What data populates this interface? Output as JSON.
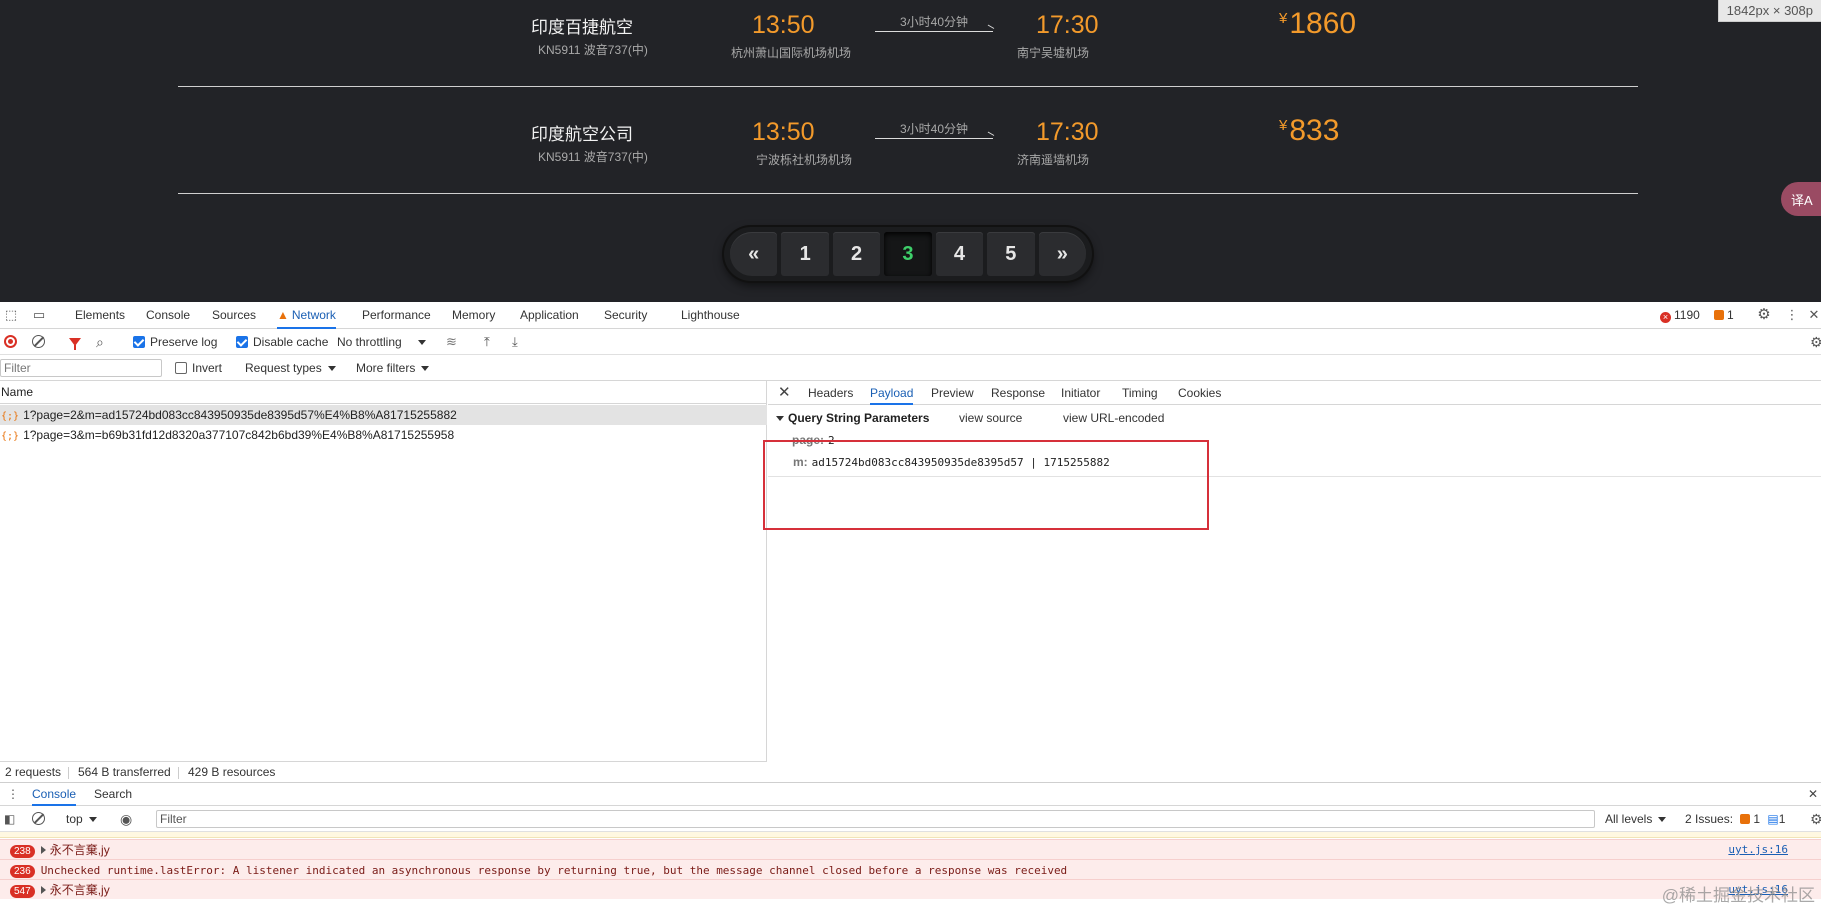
{
  "page": {
    "dimension_badge": "1842px × 308p",
    "flights": [
      {
        "airline": "印度百捷航空",
        "flight_no": "KN5911 波音737(中)",
        "dep_time": "13:50",
        "dep_airport": "杭州萧山国际机场机场",
        "duration": "3小时40分钟",
        "arr_time": "17:30",
        "arr_airport": "南宁吴墟机场",
        "currency": "¥",
        "price": "1860"
      },
      {
        "airline": "印度航空公司",
        "flight_no": "KN5911 波音737(中)",
        "dep_time": "13:50",
        "dep_airport": "宁波栎社机场机场",
        "duration": "3小时40分钟",
        "arr_time": "17:30",
        "arr_airport": "济南遥墙机场",
        "currency": "¥",
        "price": "833"
      }
    ],
    "pagination": {
      "prev": "«",
      "pages": [
        "1",
        "2",
        "3",
        "4",
        "5"
      ],
      "current": "3",
      "next": "»"
    },
    "translate_button": "译A"
  },
  "devtools": {
    "main_tabs": [
      "Elements",
      "Console",
      "Sources",
      "Network",
      "Performance",
      "Memory",
      "Application",
      "Security",
      "Lighthouse"
    ],
    "active_tab": "Network",
    "error_count": "1190",
    "warning_count": "1",
    "toolbar": {
      "preserve_log": "Preserve log",
      "disable_cache": "Disable cache",
      "throttling": "No throttling"
    },
    "filterbar": {
      "filter_placeholder": "Filter",
      "invert": "Invert",
      "request_types": "Request types",
      "more_filters": "More filters"
    },
    "requests": {
      "column_name": "Name",
      "rows": [
        "1?page=2&m=ad15724bd083cc843950935de8395d57%E4%B8%A81715255882",
        "1?page=3&m=b69b31fd12d8320a377107c842b6bd39%E4%B8%A81715255958"
      ]
    },
    "status": {
      "requests": "2 requests",
      "transferred": "564 B transferred",
      "resources": "429 B resources"
    },
    "detail_tabs": [
      "Headers",
      "Payload",
      "Preview",
      "Response",
      "Initiator",
      "Timing",
      "Cookies"
    ],
    "active_detail_tab": "Payload",
    "payload": {
      "section_title": "Query String Parameters",
      "view_source": "view source",
      "view_url_encoded": "view URL-encoded",
      "params": [
        {
          "key": "page:",
          "value": "2"
        },
        {
          "key": "m:",
          "value": "ad15724bd083cc843950935de8395d57 | 1715255882"
        }
      ]
    },
    "drawer": {
      "tabs": [
        "Console",
        "Search"
      ],
      "context": "top",
      "filter_placeholder": "Filter",
      "levels": "All levels",
      "issues_label": "2 Issues:",
      "issues_warn": "1",
      "issues_info": "1",
      "logs": [
        {
          "count": "238",
          "text": "永不言棄,jy",
          "source": "uyt.js:16"
        },
        {
          "count": "236",
          "text": "Unchecked runtime.lastError: A listener indicated an asynchronous response by returning true, but the message channel closed before a response was received",
          "source": ""
        },
        {
          "count": "547",
          "text": "永不言棄,jy",
          "source": "uyt.js:16"
        }
      ]
    },
    "watermark": "@稀土掘金技术社区"
  },
  "colors": {
    "page_bg": "#222327",
    "accent_orange": "#f39a2b",
    "active_page_green": "#3ecf6a",
    "devtools_blue": "#1a73e8",
    "error_red": "#d93025",
    "highlight_box": "#d6303a"
  }
}
